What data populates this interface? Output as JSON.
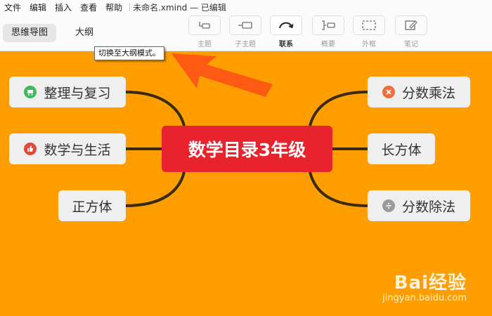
{
  "menubar": {
    "items": [
      "文件",
      "编辑",
      "插入",
      "查看",
      "帮助"
    ],
    "window_title": "未命名.xmind — 已编辑"
  },
  "view_tabs": {
    "mindmap": "思维导图",
    "outline": "大纲"
  },
  "toolbar": {
    "topic": "主题",
    "subtopic": "子主题",
    "relationship": "联系",
    "summary": "概要",
    "boundary": "外框",
    "note": "笔记"
  },
  "tooltip": "切换至大纲模式。",
  "mindmap": {
    "central_topic": "数学目录3年级",
    "left_topics": [
      "整理与复习",
      "数学与生活",
      "正方体"
    ],
    "right_topics": [
      "分数乘法",
      "长方体",
      "分数除法"
    ]
  },
  "colors": {
    "canvas": "#ff9e00",
    "central": "#e8232d",
    "arrow": "#ff5a14",
    "connector": "#3a2a10"
  },
  "icons": {
    "left_0": "shopping-cart-icon",
    "left_1": "thumbs-up-icon",
    "right_0": "multiply-icon",
    "right_2": "divide-icon"
  },
  "watermark": {
    "brand": "Bai经验",
    "url": "jingyan.baidu.com"
  }
}
